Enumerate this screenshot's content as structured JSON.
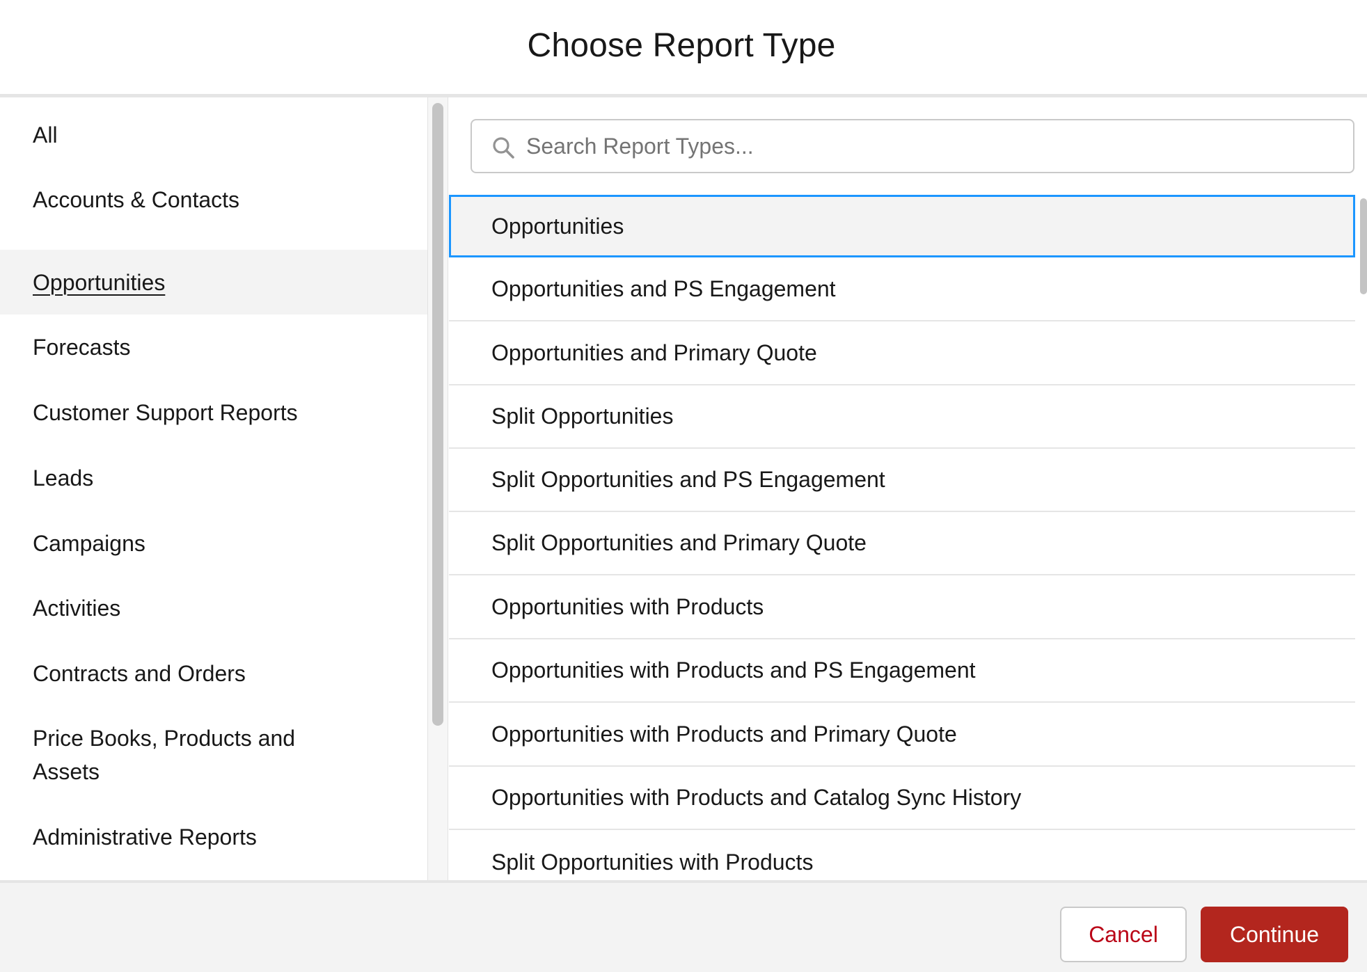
{
  "modal": {
    "title": "Choose Report Type"
  },
  "sidebar": {
    "selected_index": 2,
    "items": [
      {
        "label": "All"
      },
      {
        "label": "Accounts & Contacts"
      },
      {
        "label": "Opportunities"
      },
      {
        "label": "Forecasts"
      },
      {
        "label": "Customer Support Reports"
      },
      {
        "label": "Leads"
      },
      {
        "label": "Campaigns"
      },
      {
        "label": "Activities"
      },
      {
        "label": "Contracts and Orders"
      },
      {
        "label": "Price Books, Products and Assets"
      },
      {
        "label": "Administrative Reports"
      }
    ]
  },
  "search": {
    "placeholder": "Search Report Types...",
    "value": ""
  },
  "report_types": {
    "selected_index": 0,
    "items": [
      {
        "label": "Opportunities"
      },
      {
        "label": "Opportunities and PS Engagement"
      },
      {
        "label": "Opportunities and Primary Quote"
      },
      {
        "label": "Split Opportunities"
      },
      {
        "label": "Split Opportunities and PS Engagement"
      },
      {
        "label": "Split Opportunities and Primary Quote"
      },
      {
        "label": "Opportunities with Products"
      },
      {
        "label": "Opportunities with Products and PS Engagement"
      },
      {
        "label": "Opportunities with Products and Primary Quote"
      },
      {
        "label": "Opportunities with Products and Catalog Sync History"
      },
      {
        "label": "Split Opportunities with Products"
      }
    ]
  },
  "footer": {
    "cancel_label": "Cancel",
    "continue_label": "Continue"
  },
  "colors": {
    "brand_button": "#b3261e",
    "cancel_text": "#ba0517",
    "focus_border": "#1b96ff",
    "selected_bg": "#f3f3f3"
  },
  "icons": {
    "search": "search-icon"
  }
}
